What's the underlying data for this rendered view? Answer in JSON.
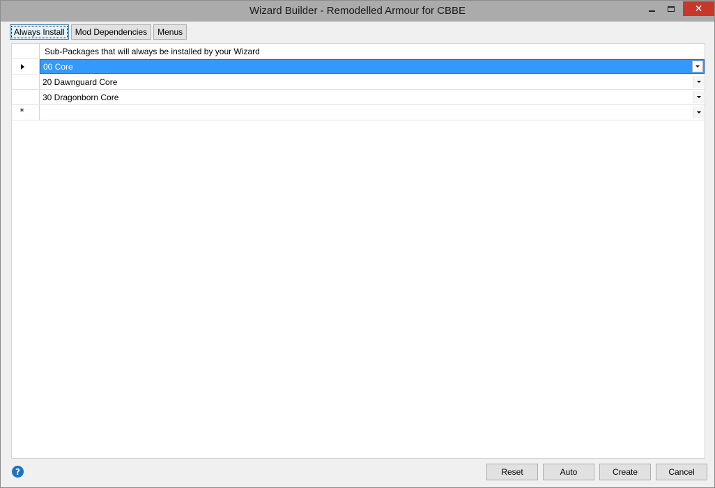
{
  "window": {
    "title": "Wizard Builder - Remodelled Armour for CBBE",
    "close_glyph": "✕"
  },
  "tabs": [
    {
      "label": "Always Install",
      "active": true
    },
    {
      "label": "Mod Dependencies",
      "active": false
    },
    {
      "label": "Menus",
      "active": false
    }
  ],
  "grid": {
    "column_header": "Sub-Packages that will always be installed by your Wizard",
    "new_row_marker": "*",
    "rows": [
      {
        "value": "00 Core",
        "selected": true
      },
      {
        "value": "20 Dawnguard Core",
        "selected": false
      },
      {
        "value": "30 Dragonborn Core",
        "selected": false
      }
    ]
  },
  "help": {
    "glyph": "?"
  },
  "buttons": {
    "reset": "Reset",
    "auto": "Auto",
    "create": "Create",
    "cancel": "Cancel"
  },
  "colors": {
    "selection": "#3399ff",
    "titlebar": "#ababab",
    "close": "#c7382b",
    "help": "#1d72c3"
  }
}
